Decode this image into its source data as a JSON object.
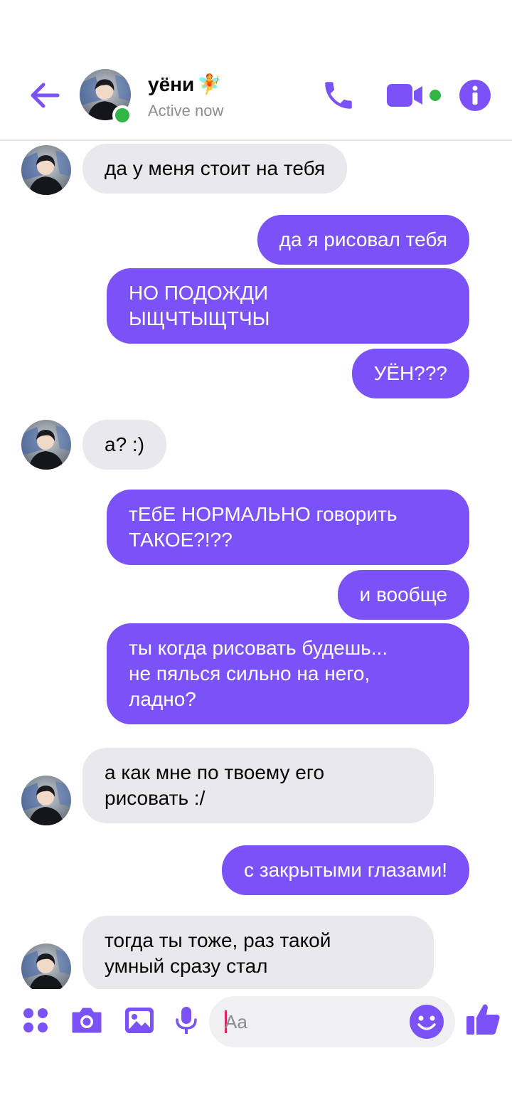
{
  "header": {
    "contact_name": "уёни",
    "contact_emoji": "🧚",
    "status": "Active now",
    "accent_color": "#7b52f8",
    "online_color": "#31b545"
  },
  "messages": [
    {
      "from": "them",
      "text": "да у меня стоит на тебя"
    },
    {
      "from": "me",
      "text": "да я рисовал тебя"
    },
    {
      "from": "me",
      "text": "НО ПОДОЖДИ\nЫЩЧТЫЩТЧЫ"
    },
    {
      "from": "me",
      "text": "УЁН???"
    },
    {
      "from": "them",
      "text": "а? :)"
    },
    {
      "from": "me",
      "text": "тЕбЕ НОРМАЛЬНО говорить\nТАКОЕ?!??"
    },
    {
      "from": "me",
      "text": "и вообще"
    },
    {
      "from": "me",
      "text": "ты когда рисовать будешь...\nне пялься сильно на него,\nладно?"
    },
    {
      "from": "them",
      "text": "а как мне по твоему его\nрисовать :/"
    },
    {
      "from": "me",
      "text": "с закрытыми глазами!"
    },
    {
      "from": "them",
      "text": "тогда ты тоже, раз такой\nумный сразу стал"
    }
  ],
  "composer": {
    "placeholder": "Aa"
  },
  "icons": [
    "back-arrow-icon",
    "phone-icon",
    "video-camera-icon",
    "info-icon",
    "apps-grid-icon",
    "camera-icon",
    "gallery-icon",
    "microphone-icon",
    "emoji-icon",
    "thumbs-up-icon"
  ]
}
